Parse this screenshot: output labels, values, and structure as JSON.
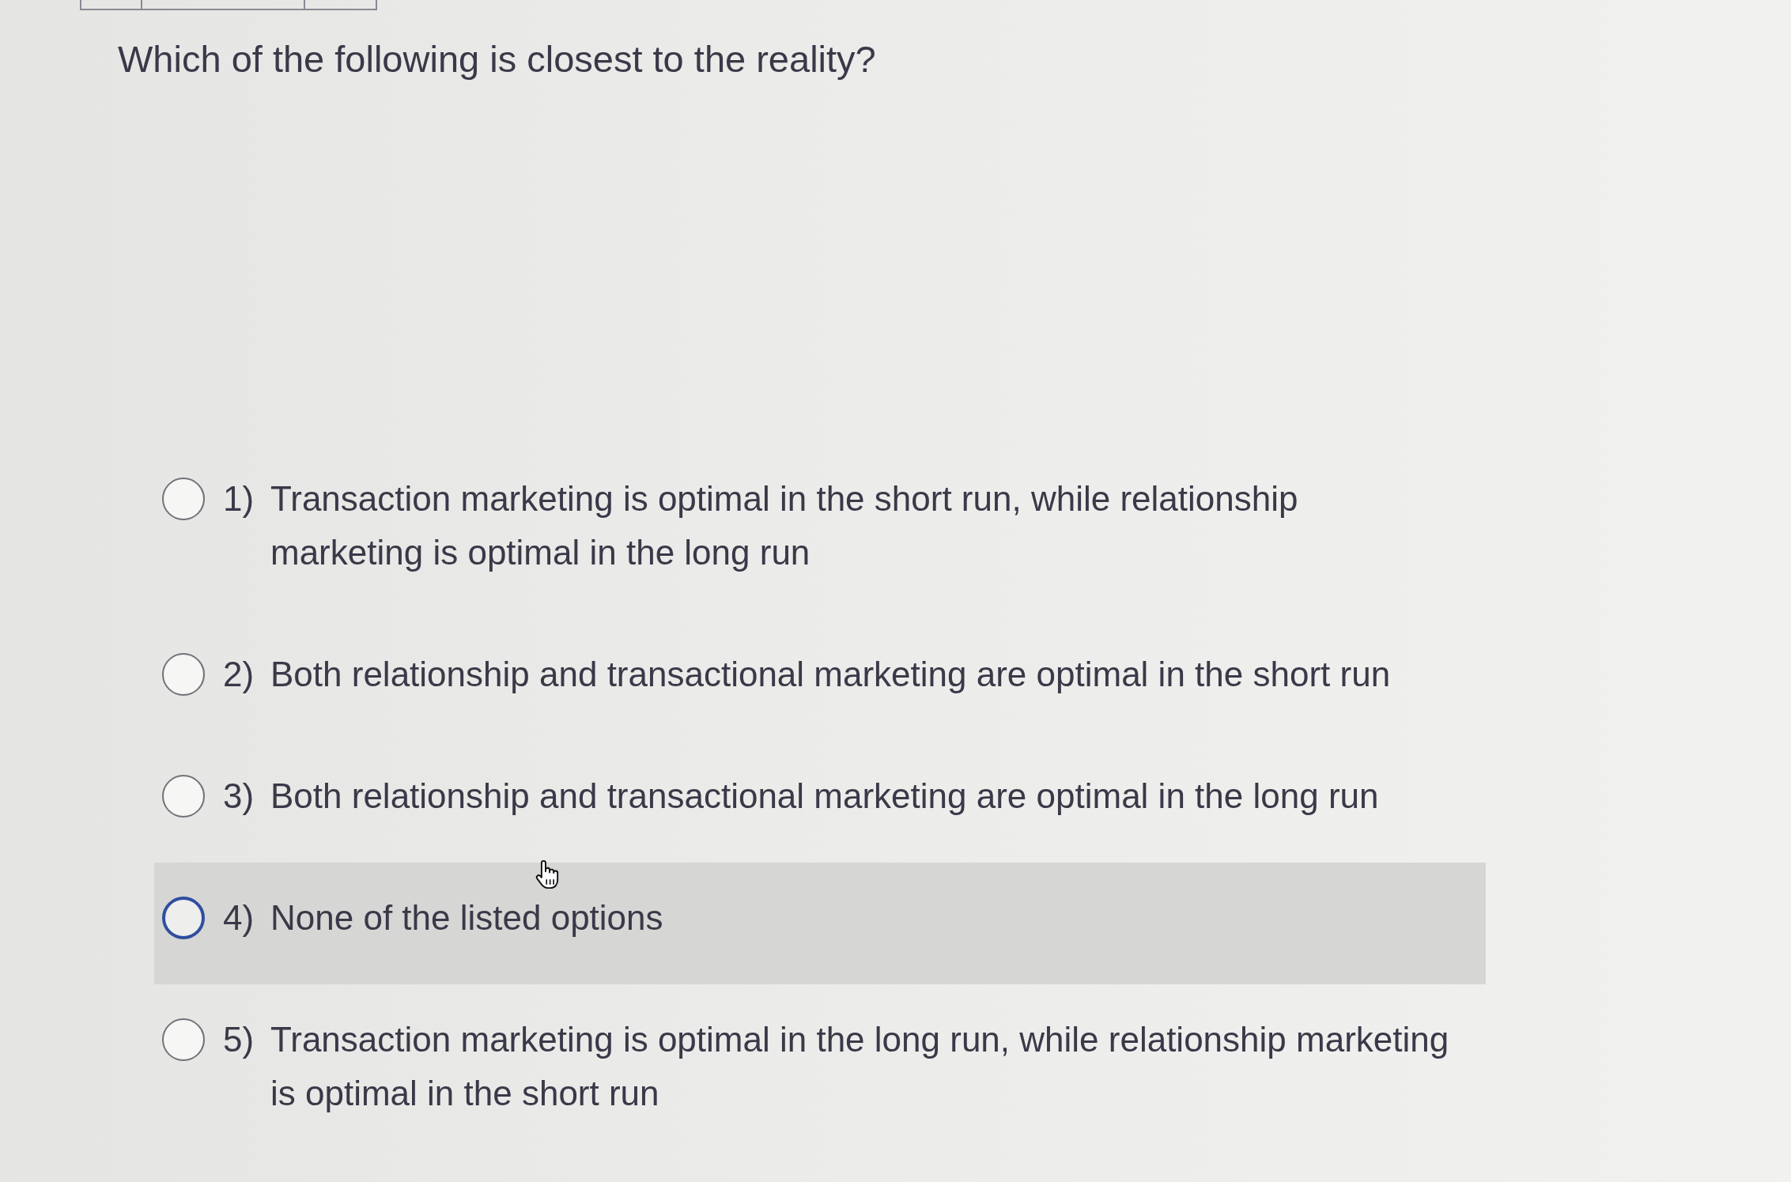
{
  "question": "Which of the following is closest to the reality?",
  "options": [
    {
      "number": "1)",
      "text": "Transaction marketing is optimal in the short run, while relationship marketing is optimal in the long run",
      "selected": false,
      "highlighted": false
    },
    {
      "number": "2)",
      "text": "Both relationship and transactional marketing are optimal in the short run",
      "selected": false,
      "highlighted": false
    },
    {
      "number": "3)",
      "text": "Both relationship and transactional marketing are optimal in the long run",
      "selected": false,
      "highlighted": false
    },
    {
      "number": "4)",
      "text": "None of the listed options",
      "selected": false,
      "highlighted": true
    },
    {
      "number": "5)",
      "text": "Transaction marketing is optimal in the long run, while relationship marketing is optimal in the short run",
      "selected": false,
      "highlighted": false
    }
  ]
}
